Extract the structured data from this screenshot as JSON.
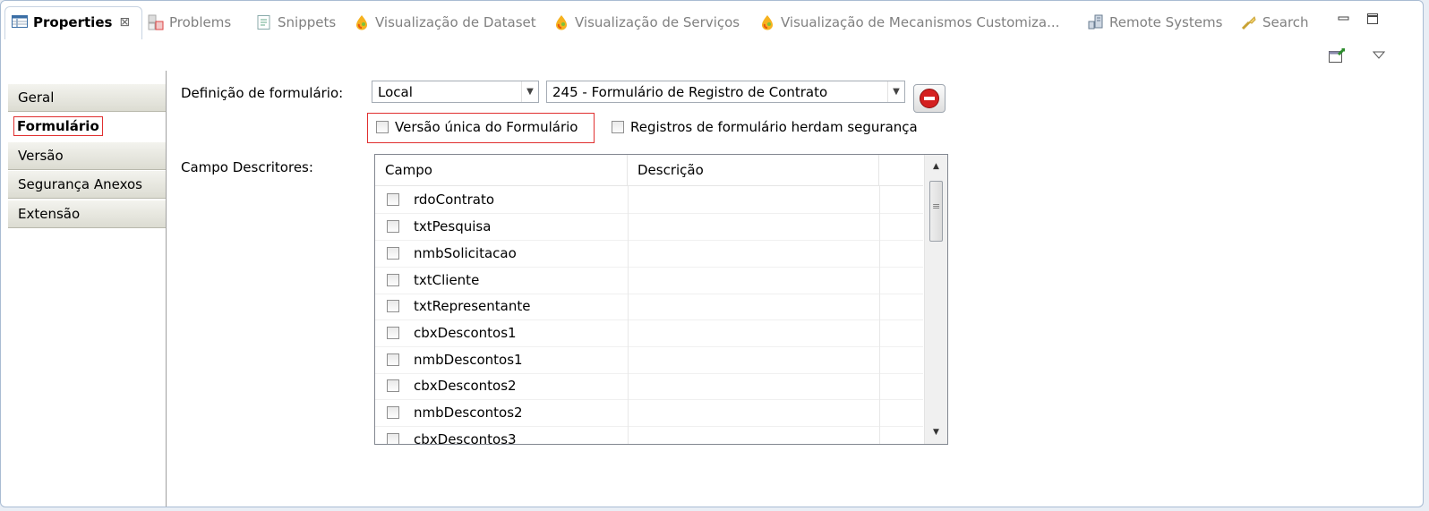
{
  "tabs": [
    {
      "label": "Properties",
      "close": "⊠",
      "icon": "properties-icon"
    },
    {
      "label": "Problems",
      "icon": "problems-icon"
    },
    {
      "label": "Snippets",
      "icon": "snippets-icon"
    },
    {
      "label": "Visualização de Dataset",
      "icon": "drop-icon"
    },
    {
      "label": "Visualização de Serviços",
      "icon": "drop-icon"
    },
    {
      "label": "Visualização de Mecanismos Customiza...",
      "icon": "drop-icon"
    },
    {
      "label": "Remote Systems",
      "icon": "remote-systems-icon"
    },
    {
      "label": "Search",
      "icon": "search-icon"
    }
  ],
  "nav": {
    "items": [
      "Geral",
      "Formulário",
      "Versão",
      "Segurança Anexos",
      "Extensão"
    ],
    "selected": "Formulário"
  },
  "form": {
    "definition_label": "Definição de formulário:",
    "location_value": "Local",
    "form_value": "245 - Formulário de Registro de Contrato",
    "single_version_label": "Versão única do Formulário",
    "inherit_security_label": "Registros de formulário herdam segurança",
    "descriptors_label": "Campo Descritores:"
  },
  "table": {
    "columns": [
      "Campo",
      "Descrição"
    ],
    "rows": [
      "rdoContrato",
      "txtPesquisa",
      "nmbSolicitacao",
      "txtCliente",
      "txtRepresentante",
      "cbxDescontos1",
      "nmbDescontos1",
      "cbxDescontos2",
      "nmbDescontos2",
      "cbxDescontos3"
    ]
  },
  "colors": {
    "accent_red": "#e03030",
    "tab_inactive": "#808080"
  }
}
